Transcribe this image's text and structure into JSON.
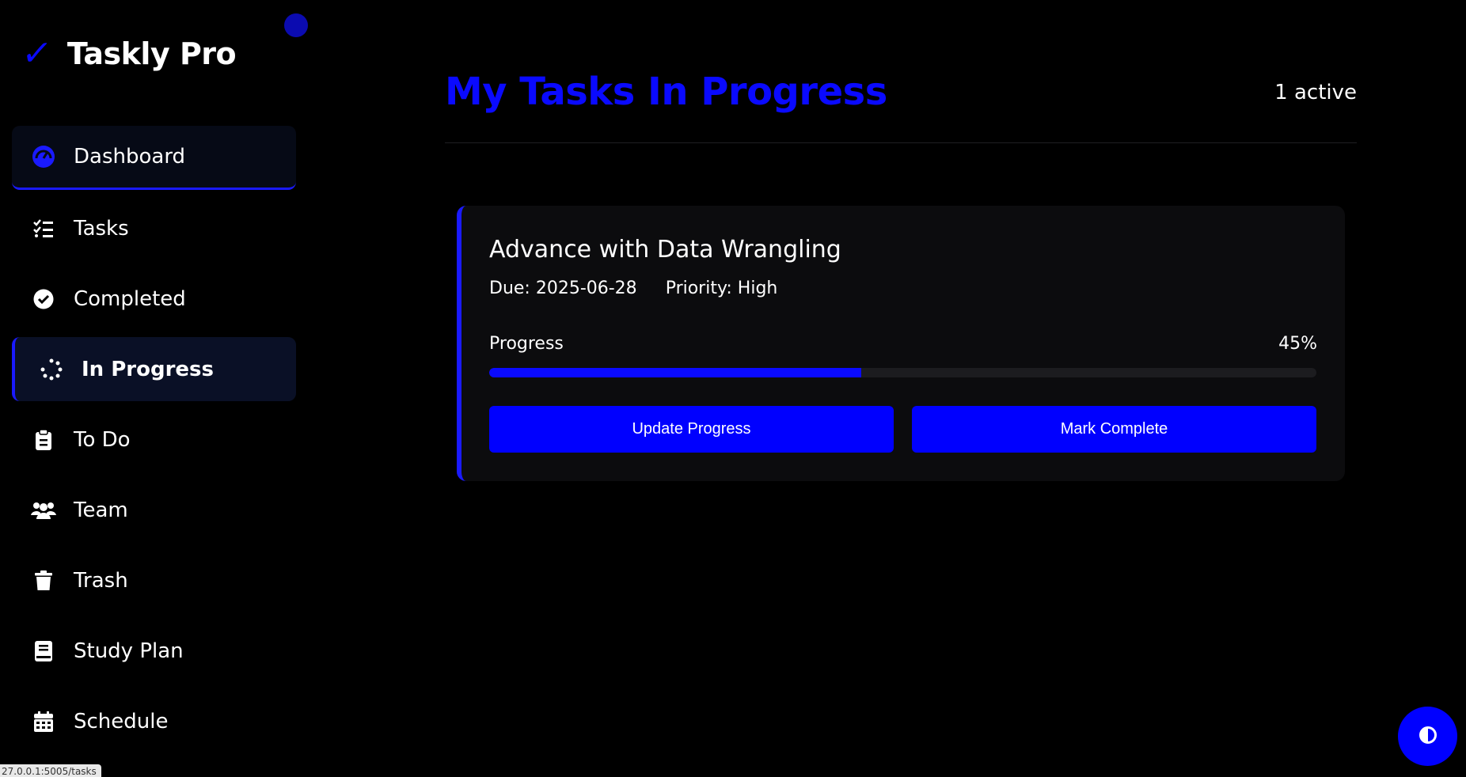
{
  "brand": {
    "check": "✓",
    "name": "Taskly Pro"
  },
  "sidebar": {
    "items": [
      {
        "label": "Dashboard",
        "icon": "gauge-icon"
      },
      {
        "label": "Tasks",
        "icon": "list-check-icon"
      },
      {
        "label": "Completed",
        "icon": "check-circle-icon"
      },
      {
        "label": "In Progress",
        "icon": "spinner-icon"
      },
      {
        "label": "To Do",
        "icon": "clipboard-icon"
      },
      {
        "label": "Team",
        "icon": "users-icon"
      },
      {
        "label": "Trash",
        "icon": "trash-icon"
      },
      {
        "label": "Study Plan",
        "icon": "book-icon"
      },
      {
        "label": "Schedule",
        "icon": "calendar-icon"
      }
    ],
    "active": "In Progress"
  },
  "header": {
    "title": "My Tasks In Progress",
    "active_count": "1 active"
  },
  "task": {
    "title": "Advance with Data Wrangling",
    "due": "Due: 2025-06-28",
    "priority": "Priority: High",
    "progress_label": "Progress",
    "progress_text": "45%",
    "progress": 0.45,
    "update_label": "Update Progress",
    "complete_label": "Mark Complete"
  },
  "status_bar": {
    "url": "27.0.0.1:5005/tasks"
  },
  "colors": {
    "accent": "#0a0aff",
    "button": "#0000ff",
    "background": "#000000",
    "card": "#0c0c0e"
  }
}
